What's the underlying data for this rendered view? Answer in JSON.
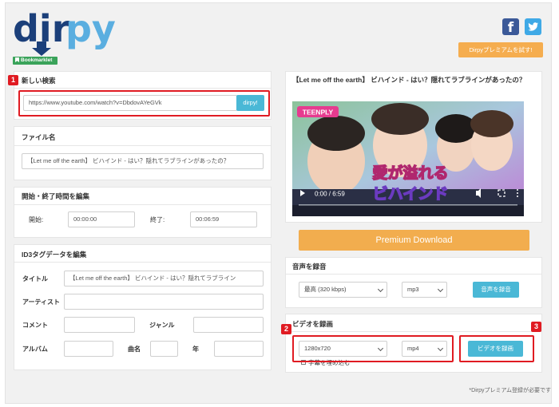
{
  "brand": {
    "logo_text_dark": "dir",
    "logo_text_light": "py",
    "bookmarklet": "Bookmarklet"
  },
  "header": {
    "facebook_icon": "f",
    "premium_try": "Dirpyプレミアムを試す!"
  },
  "search": {
    "title": "新しい検索",
    "url": "https://www.youtube.com/watch?v=DbdovAYeGVk",
    "button": "dirpy!"
  },
  "filename": {
    "title": "ファイル名",
    "value": "【Let me off the earth】 ビハインド - はい？隠れてラブラインがあったの？"
  },
  "time": {
    "title": "開始・終了時間を編集",
    "start_label": "開始:",
    "start": "00:00:00",
    "end_label": "終了:",
    "end": "00:06:59"
  },
  "id3": {
    "title": "ID3タグデータを編集",
    "title_label": "タイトル",
    "title_value": "【Let me off the earth】 ビハインド - はい？隠れてラブライン",
    "artist_label": "アーティスト",
    "artist_value": "",
    "comment_label": "コメント",
    "genre_label": "ジャンル",
    "album_label": "アルバム",
    "track_label": "曲名",
    "year_label": "年"
  },
  "video_panel": {
    "title": "【Let me off the earth】 ビハインド - はい？隠れてラブラインがあったの？",
    "channel_tag": "TEENPLY",
    "caption_line1": "愛が溢れる",
    "caption_line2": "ビハインド",
    "time_display": "0:00 / 6:59"
  },
  "premium_download": "Premium Download",
  "audio": {
    "title": "音声を録音",
    "quality": "最高 (320 kbps)",
    "format": "mp3",
    "button": "音声を録音"
  },
  "video_rec": {
    "title": "ビデオを録画",
    "resolution": "1280x720",
    "format": "mp4",
    "button": "ビデオを録画",
    "subtitle_label": "字幕を埋め込む"
  },
  "note": "*Dirpyプレミアム登録が必要です",
  "badges": [
    "1",
    "2",
    "3"
  ],
  "colors": {
    "accent_blue": "#4ab8d6",
    "premium_orange": "#f5ad4f",
    "annotation_red": "#e01b22",
    "logo_navy": "#1b3f7a",
    "logo_blue": "#5aaee0"
  }
}
